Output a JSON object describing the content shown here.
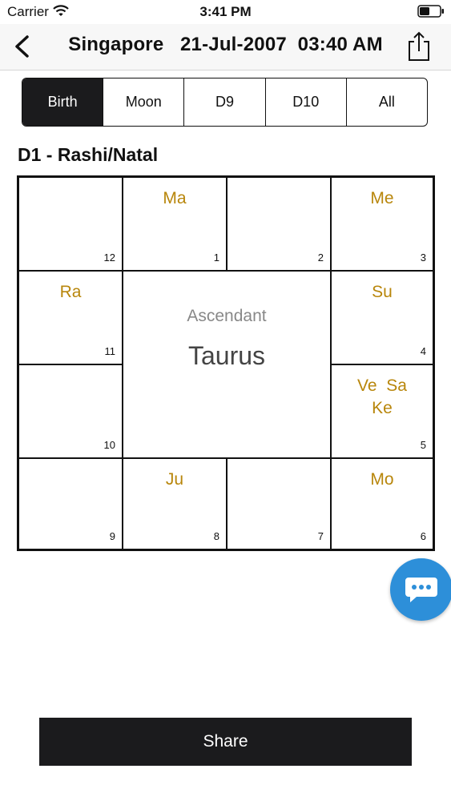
{
  "status_bar": {
    "carrier": "Carrier",
    "time": "3:41 PM"
  },
  "nav": {
    "title": "Singapore   21-Jul-2007  03:40 AM",
    "back_icon": "chevron-left-icon",
    "share_icon": "share-icon"
  },
  "tabs": [
    {
      "label": "Birth",
      "active": true
    },
    {
      "label": "Moon",
      "active": false
    },
    {
      "label": "D9",
      "active": false
    },
    {
      "label": "D10",
      "active": false
    },
    {
      "label": "All",
      "active": false
    }
  ],
  "chart_title": "D1 - Rashi/Natal",
  "chart": {
    "center": {
      "label": "Ascendant",
      "sign": "Taurus"
    },
    "planet_color": "#b8860b",
    "houses": [
      {
        "house": "12",
        "planets": ""
      },
      {
        "house": "1",
        "planets": "Ma"
      },
      {
        "house": "2",
        "planets": ""
      },
      {
        "house": "3",
        "planets": "Me"
      },
      {
        "house": "11",
        "planets": "Ra"
      },
      {
        "house": "4",
        "planets": "Su"
      },
      {
        "house": "10",
        "planets": ""
      },
      {
        "house": "5",
        "planets": "Ve  Sa\nKe"
      },
      {
        "house": "9",
        "planets": ""
      },
      {
        "house": "8",
        "planets": "Ju"
      },
      {
        "house": "7",
        "planets": ""
      },
      {
        "house": "6",
        "planets": "Mo"
      }
    ]
  },
  "chat_fab": {
    "icon": "chat-bubble-icon",
    "color": "#2d8fd9"
  },
  "share_button": {
    "label": "Share"
  }
}
